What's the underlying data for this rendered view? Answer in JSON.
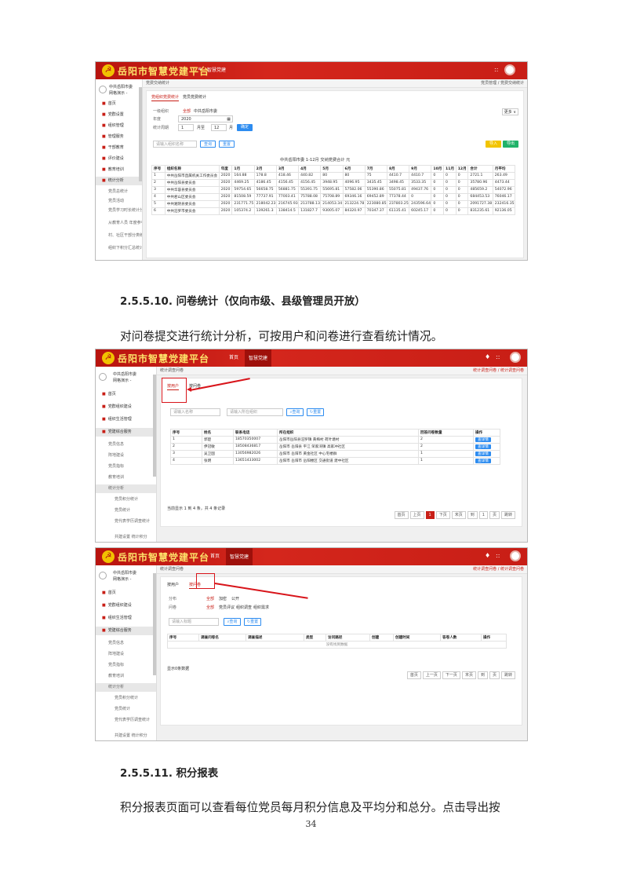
{
  "shot1": {
    "brand": "岳阳市智慧党建平台",
    "menu_icon": "hamburger-icon",
    "nav_item": "智慧党建",
    "profile": [
      "中共岳阳市委",
      "网格演示 -"
    ],
    "side_items": [
      "首页",
      "党群设置",
      "组织管理",
      "管理服务",
      "干部教育",
      "评价建设",
      "教育培训",
      "统计分析"
    ],
    "side_subs": [
      "党员总统计",
      "党员活动",
      "党员学习时长统计分析",
      "从教育人员 年度参与统计",
      "村、社区干部分类统计",
      "组织下积分汇总统计"
    ],
    "crumb": "党费交纳统计",
    "crumb_right": "党员管理 / 党费交纳统计",
    "tabs": [
      "党组织党费统计",
      "党员党费统计"
    ],
    "filter_labels": [
      "一级组织",
      "年度",
      "统计周期"
    ],
    "org_options": [
      "全部",
      "中共岳阳市委"
    ],
    "year": "2020",
    "period_from": "1",
    "period_unit_a": "月至",
    "period_to": "12",
    "period_unit_b": "月",
    "confirm": "确定",
    "more": "更多",
    "search_placeholder": "请输入组织名称",
    "query": "查询",
    "reset": "重置",
    "import": "导入",
    "export": "导出",
    "table_title": "中共岳阳市委 1-12月 交纳党费合计 元",
    "headers": [
      "序号",
      "组织名称",
      "年度",
      "1月",
      "2月",
      "3月",
      "4月",
      "5月",
      "6月",
      "7月",
      "8月",
      "9月",
      "10月",
      "11月",
      "12月",
      "合计",
      "月平均"
    ],
    "rows": [
      [
        "1",
        "中共岳阳市直属机关工作委员会",
        "2020",
        "164.88",
        "178.8",
        "418.46",
        "440.82",
        "80",
        "80",
        "75",
        "4410.7",
        "4410.7",
        "0",
        "0",
        "0",
        "2721.1",
        "263.49"
      ],
      [
        "2",
        "中共岳阳县委员会",
        "2020",
        "4469.25",
        "4186.45",
        "4156.45",
        "4156.45",
        "3948.95",
        "4096.95",
        "3435.45",
        "3498.45",
        "3533.35",
        "0",
        "0",
        "0",
        "35780.96",
        "4473.44"
      ],
      [
        "3",
        "中共华容县委员会",
        "2020",
        "59754.65",
        "56658.75",
        "56881.75",
        "55391.75",
        "55695.81",
        "57582.06",
        "55390.86",
        "55075.81",
        "49437.76",
        "0",
        "0",
        "0",
        "485659.2",
        "54072.96"
      ],
      [
        "4",
        "中共君山区委员会",
        "2020",
        "81508.59",
        "77737.91",
        "77003.41",
        "75788.08",
        "75708.89",
        "69346.16",
        "69452.89",
        "77378.44",
        "0",
        "0",
        "0",
        "0",
        "684453.53",
        "76046.17"
      ],
      [
        "5",
        "中共湘阴县委员会",
        "2020",
        "231771.75",
        "218042.23",
        "216745.93",
        "213788.13",
        "214053.34",
        "213224.78",
        "223080.85",
        "237803.25",
        "243596.64",
        "0",
        "0",
        "0",
        "2091727.38",
        "232416.35"
      ],
      [
        "6",
        "中共汨罗市委员会",
        "2020",
        "105374.2",
        "139261.3",
        "138414.5",
        "131827.7",
        "93005.07",
        "84320.97",
        "70347.37",
        "61135.41",
        "60245.17",
        "0",
        "0",
        "0",
        "831235.61",
        "92136.05"
      ]
    ]
  },
  "section1": {
    "heading": "2.5.5.10. 问卷统计（仅向市级、县级管理员开放）",
    "body": "对问卷提交进行统计分析，可按用户和问卷进行查看统计情况。"
  },
  "shot2": {
    "brand": "岳阳市智慧党建平台",
    "nav": [
      "首页",
      "智慧党建"
    ],
    "profile": [
      "中共岳阳市委",
      "网格演示 -"
    ],
    "side_items": [
      "首页",
      "党群组织建设",
      "组织生活管理",
      "党建综合服务"
    ],
    "side_subs": [
      "党员信息",
      "阵地建设",
      "党员指标",
      "教育培训",
      "统计分析"
    ],
    "side_subsubs": [
      "党员积分统计",
      "党员统计",
      "党代表学历调查统计",
      "共建设置 统计积分"
    ],
    "crumb": "统计调查问卷",
    "crumb_right": "统计调查问卷 / 统计调查问卷",
    "tabs": [
      "按用户",
      "按问卷"
    ],
    "search_placeholder1": "请输入名称",
    "search_placeholder2": "请输入所在组织",
    "query": "查询",
    "reset": "重置",
    "headers": [
      "序号",
      "姓名",
      "联系电话",
      "所在组织",
      "回答问卷数量",
      "操作"
    ],
    "rows": [
      [
        "1",
        "郭楚",
        "18570350007",
        "岳阳市岳阳县汨罗镇 黄梅村 荷叶塘村",
        "2",
        "查详情"
      ],
      [
        "2",
        "伊冠敏",
        "18508436817",
        "岳阳市 岳阳县 平江 荣家湾镇 高家冲社区",
        "2",
        "查详情"
      ],
      [
        "3",
        "吴卫国",
        "13056982026",
        "岳阳市 岳阳市 黄金社区 中心宅楼群",
        "1",
        "查详情"
      ],
      [
        "4",
        "张明",
        "13651433002",
        "岳阳市 岳阳市 岳阳楼区 交通街道 建中社区",
        "1",
        "查详情"
      ]
    ],
    "footer": "当前显示 1 到 4 条，共 4 条记录",
    "pager": [
      "首页",
      "上页",
      "1",
      "下页",
      "末页",
      "到",
      "1",
      "页",
      "跳转"
    ]
  },
  "shot3": {
    "brand": "岳阳市智慧党建平台",
    "nav": [
      "首页",
      "智慧党建"
    ],
    "profile": [
      "中共岳阳市委",
      "网格演示 -"
    ],
    "side_items": [
      "首页",
      "党群组织建设",
      "组织生活管理",
      "党建综合服务"
    ],
    "side_subs": [
      "党员信息",
      "阵地建设",
      "党员指标",
      "教育培训",
      "统计分析"
    ],
    "side_subsubs": [
      "党员积分统计",
      "党员统计",
      "党代表学历调查统计",
      "共建设置 统计积分"
    ],
    "crumb": "统计调查问卷",
    "crumb_right": "统计调查问卷 / 统计调查问卷",
    "tabs": [
      "按用户",
      "按问卷"
    ],
    "filter1_label": "分布",
    "filter1": [
      "全部",
      "加密",
      "公开"
    ],
    "filter2_label": "问卷",
    "filter2": [
      "全部",
      "党员评议",
      "组织调查",
      "组织需求"
    ],
    "search_placeholder": "请输入标题",
    "query": "查询",
    "reset": "重置",
    "headers": [
      "序号",
      "调查问卷名",
      "调查描述",
      "类型",
      "访问路径",
      "创建",
      "创建时间",
      "答卷人数",
      "操作"
    ],
    "empty": "没有找到数据",
    "footer": "显示0条数据",
    "pager": [
      "首页",
      "上一页",
      "下一页",
      "末页",
      "到",
      "页",
      "跳转"
    ]
  },
  "section2": {
    "heading": "2.5.5.11. 积分报表",
    "body": "积分报表页面可以查看每位党员每月积分信息及平均分和总分。点击导出按"
  },
  "page_number": "34"
}
